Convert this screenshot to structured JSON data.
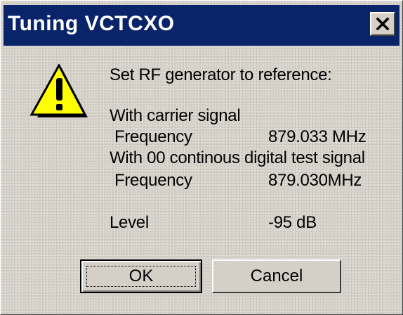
{
  "window": {
    "title": "Tuning VCTCXO"
  },
  "message": {
    "heading": "Set RF generator to reference:",
    "carrier_header": "With carrier signal",
    "carrier_freq_label": "Frequency",
    "carrier_freq_value": "879.033 MHz",
    "digital_header": "With  00 continous digital test signal",
    "digital_freq_label": "Frequency",
    "digital_freq_value": "879.030MHz",
    "level_label": "Level",
    "level_value": "-95 dB"
  },
  "buttons": {
    "ok": "OK",
    "cancel": "Cancel"
  },
  "icons": {
    "title_close": "close-icon",
    "dialog": "warning-icon"
  },
  "colors": {
    "titlebar": "#0a246a",
    "dialog_bg": "#d4d0c8",
    "warning_fill": "#ffff00"
  }
}
